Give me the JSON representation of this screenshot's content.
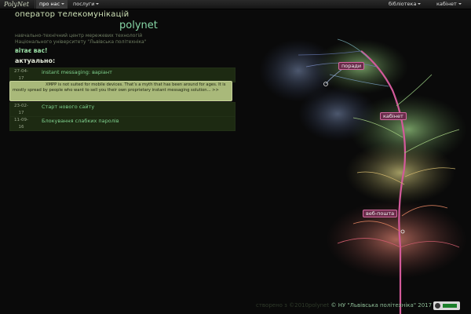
{
  "navbar": {
    "brand": "PolyNet",
    "items": [
      {
        "label": "про нас",
        "active": true
      },
      {
        "label": "послуги",
        "active": false
      }
    ],
    "right": [
      {
        "label": "бібліотека"
      },
      {
        "label": "кабінет"
      }
    ]
  },
  "header": {
    "tagline": "оператор телекомунікацій",
    "title": "polynet",
    "sub_lines": [
      "навчально-технічний центр мережевих технологій",
      "Національного університету \"Львівська політехніка\""
    ],
    "greeting": "вітає вас!"
  },
  "news": {
    "heading": "актуально:",
    "items": [
      {
        "date_top": "27-04-",
        "date_bottom": "17",
        "title": "instant messaging: варіант"
      },
      {
        "date_top": "23-02-",
        "date_bottom": "17",
        "title": "Старт нового сайту"
      },
      {
        "date_top": "11-09-",
        "date_bottom": "16",
        "title": "Блокування слабких паролів"
      }
    ],
    "popup": "XMPP is not suited for mobile devices. That’s a myth that has been around for ages. It is mostly spread by people who want to sell you their own proprietary instant messaging solution... >>"
  },
  "tree_tags": {
    "tag1": "поради",
    "tag2": "кабінет",
    "tag3": "веб-пошта"
  },
  "footer": {
    "ack": "створено з ©2010polynet",
    "copy": "© НУ \"Львівська політехніка\" 2017"
  },
  "colors": {
    "background": "#0a0a0a",
    "accent": "#86d6a6",
    "news_row": "#1d2a12",
    "popup": "#a9b97a",
    "tag": "#6b2b4a"
  }
}
